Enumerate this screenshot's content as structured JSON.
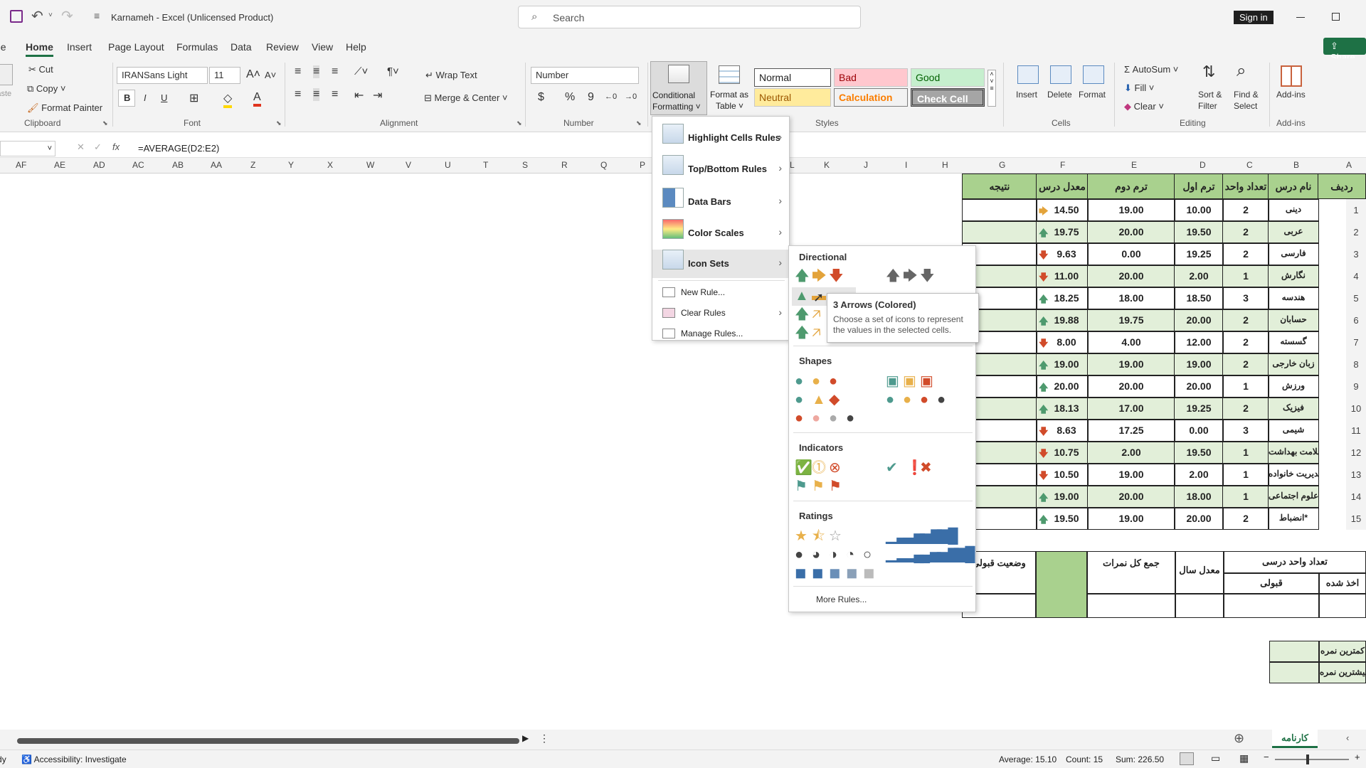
{
  "title": "Karnameh  -  Excel (Unlicensed Product)",
  "search_placeholder": "Search",
  "sign_in": "Sign in",
  "share": "Share",
  "tabs": [
    "File",
    "Home",
    "Insert",
    "Page Layout",
    "Formulas",
    "Data",
    "Review",
    "View",
    "Help"
  ],
  "clipboard": {
    "cut": "Cut",
    "copy": "Copy",
    "painter": "Format Painter",
    "paste": "Paste",
    "label": "Clipboard"
  },
  "font": {
    "name": "IRANSans Light",
    "size": "11",
    "label": "Font",
    "bold": "B",
    "italic": "I",
    "underline": "U"
  },
  "alignment": {
    "wrap": "Wrap Text",
    "merge": "Merge & Center",
    "label": "Alignment"
  },
  "number": {
    "format": "Number",
    "label": "Number",
    "currency": "$",
    "percent": "%",
    "comma": "9"
  },
  "cf": {
    "label1": "Conditional",
    "label2": "Formatting ˅"
  },
  "fat": {
    "label1": "Format as",
    "label2": "Table ˅"
  },
  "styles": {
    "normal": "Normal",
    "bad": "Bad",
    "good": "Good",
    "neutral": "Neutral",
    "calc": "Calculation",
    "check": "Check Cell",
    "label": "Styles"
  },
  "cells": {
    "insert": "Insert",
    "delete": "Delete",
    "format": "Format",
    "label": "Cells"
  },
  "editing": {
    "autosum": "AutoSum",
    "fill": "Fill",
    "clear": "Clear",
    "sort": "Sort &",
    "sort2": "Filter",
    "find": "Find &",
    "find2": "Select",
    "label": "Editing"
  },
  "addins": {
    "btn": "Add-ins",
    "label": "Add-ins"
  },
  "formula": "=AVERAGE(D2:E2)",
  "fx": "fx",
  "columns": [
    "AF",
    "AE",
    "AD",
    "AC",
    "AB",
    "AA",
    "Z",
    "Y",
    "X",
    "W",
    "V",
    "U",
    "T",
    "S",
    "R",
    "Q",
    "P",
    "L",
    "K",
    "J",
    "I",
    "H",
    "G",
    "F",
    "E",
    "D",
    "C",
    "B",
    "A"
  ],
  "cf_menu": [
    "Highlight Cells Rules",
    "Top/Bottom Rules",
    "Data Bars",
    "Color Scales",
    "Icon Sets",
    "New Rule...",
    "Clear Rules",
    "Manage Rules..."
  ],
  "iconsets": {
    "directional": "Directional",
    "shapes": "Shapes",
    "indicators": "Indicators",
    "ratings": "Ratings",
    "more": "More Rules..."
  },
  "tooltip": {
    "title": "3 Arrows (Colored)",
    "body": "Choose a set of icons to represent the values in the selected cells."
  },
  "headers": {
    "a": "ردیف",
    "b": "نام درس",
    "c": "تعداد واحد",
    "d": "ترم اول",
    "e": "ترم دوم",
    "f": "معدل درس",
    "g": "نتیجه"
  },
  "rows": [
    {
      "n": "1",
      "b": "دینی",
      "c": "2",
      "d": "10.00",
      "e": "19.00",
      "f": "14.50",
      "dir": "side"
    },
    {
      "n": "2",
      "b": "عربی",
      "c": "2",
      "d": "19.50",
      "e": "20.00",
      "f": "19.75",
      "dir": "up"
    },
    {
      "n": "3",
      "b": "فارسی",
      "c": "2",
      "d": "19.25",
      "e": "0.00",
      "f": "9.63",
      "dir": "down"
    },
    {
      "n": "4",
      "b": "نگارش",
      "c": "1",
      "d": "2.00",
      "e": "20.00",
      "f": "11.00",
      "dir": "down"
    },
    {
      "n": "5",
      "b": "هندسه",
      "c": "3",
      "d": "18.50",
      "e": "18.00",
      "f": "18.25",
      "dir": "up"
    },
    {
      "n": "6",
      "b": "حسابان",
      "c": "2",
      "d": "20.00",
      "e": "19.75",
      "f": "19.88",
      "dir": "up"
    },
    {
      "n": "7",
      "b": "گسسته",
      "c": "2",
      "d": "12.00",
      "e": "4.00",
      "f": "8.00",
      "dir": "down"
    },
    {
      "n": "8",
      "b": "زبان خارجی",
      "c": "2",
      "d": "19.00",
      "e": "19.00",
      "f": "19.00",
      "dir": "up"
    },
    {
      "n": "9",
      "b": "ورزش",
      "c": "1",
      "d": "20.00",
      "e": "20.00",
      "f": "20.00",
      "dir": "up"
    },
    {
      "n": "10",
      "b": "فیزیک",
      "c": "2",
      "d": "19.25",
      "e": "17.00",
      "f": "18.13",
      "dir": "up"
    },
    {
      "n": "11",
      "b": "شیمی",
      "c": "3",
      "d": "0.00",
      "e": "17.25",
      "f": "8.63",
      "dir": "down"
    },
    {
      "n": "12",
      "b": "سلامت بهداشت",
      "c": "1",
      "d": "19.50",
      "e": "2.00",
      "f": "10.75",
      "dir": "down"
    },
    {
      "n": "13",
      "b": "مدیریت خانواده",
      "c": "1",
      "d": "2.00",
      "e": "19.00",
      "f": "10.50",
      "dir": "down"
    },
    {
      "n": "14",
      "b": "علوم اجتماعی",
      "c": "1",
      "d": "18.00",
      "e": "20.00",
      "f": "19.00",
      "dir": "up"
    },
    {
      "n": "15",
      "b": "انضباط*",
      "c": "2",
      "d": "20.00",
      "e": "19.00",
      "f": "19.50",
      "dir": "up"
    }
  ],
  "summary": {
    "units": "تعداد واحد درسی",
    "accepted": "قبولی",
    "taken": "اخذ شده",
    "avg": "معدل سال",
    "total": "جمع کل نمرات",
    "status": "وضعیت قبولی",
    "min": "کمترین نمره",
    "max": "بیشترین نمره"
  },
  "sheet": "کارنامه",
  "status": {
    "ready": "Ready",
    "access": "Accessibility: Investigate",
    "average": "Average: 15.10",
    "count": "Count: 15",
    "sum": "Sum: 226.50"
  },
  "colors": {
    "green_light": "#e2efd9",
    "green_hdr": "#a9d18e",
    "up": "#4e9a6e",
    "down": "#d14b2a",
    "side": "#e3a33a"
  }
}
